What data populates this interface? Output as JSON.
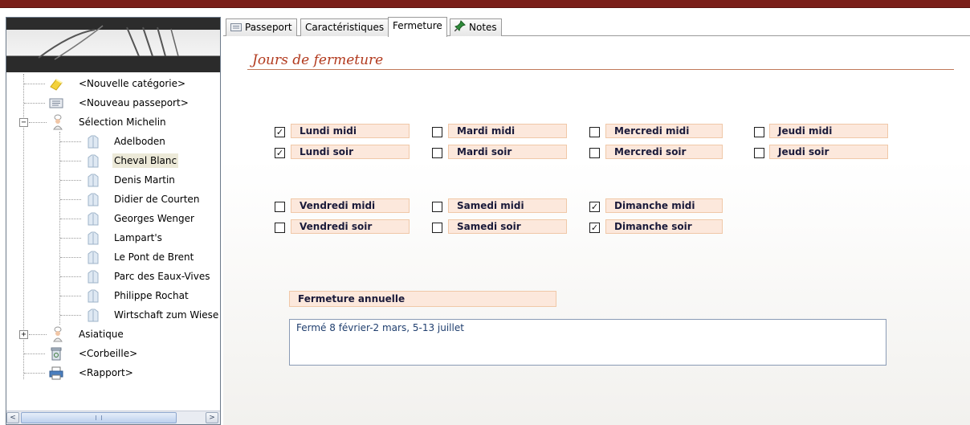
{
  "tree": {
    "items": [
      {
        "label": "<Nouvelle catégorie>",
        "icon": "folder-icon"
      },
      {
        "label": "<Nouveau passeport>",
        "icon": "document-icon"
      },
      {
        "label": "Sélection Michelin",
        "icon": "chef-icon",
        "expanded": true
      },
      {
        "label": "Adelboden",
        "icon": "chef-jacket-icon"
      },
      {
        "label": "Cheval Blanc",
        "icon": "chef-jacket-icon",
        "selected": true
      },
      {
        "label": "Denis Martin",
        "icon": "chef-jacket-icon"
      },
      {
        "label": "Didier de Courten",
        "icon": "chef-jacket-icon"
      },
      {
        "label": "Georges Wenger",
        "icon": "chef-jacket-icon"
      },
      {
        "label": "Lampart's",
        "icon": "chef-jacket-icon"
      },
      {
        "label": "Le Pont de Brent",
        "icon": "chef-jacket-icon"
      },
      {
        "label": "Parc des Eaux-Vives",
        "icon": "chef-jacket-icon"
      },
      {
        "label": "Philippe Rochat",
        "icon": "chef-jacket-icon"
      },
      {
        "label": "Wirtschaft zum Wiese",
        "icon": "chef-jacket-icon"
      },
      {
        "label": "Asiatique",
        "icon": "chef-icon",
        "expanded": false
      },
      {
        "label": "<Corbeille>",
        "icon": "recycle-bin-icon"
      },
      {
        "label": "<Rapport>",
        "icon": "printer-icon"
      }
    ],
    "expand_minus": "−",
    "expand_plus": "+",
    "scroll_left": "<",
    "scroll_right": ">"
  },
  "tabs": [
    {
      "label": "Passeport",
      "icon": "passport-icon",
      "active": false
    },
    {
      "label": "Caractéristiques",
      "active": false
    },
    {
      "label": "Fermeture",
      "active": true
    },
    {
      "label": "Notes",
      "icon": "pushpin-icon",
      "active": false
    }
  ],
  "closing": {
    "title": "Jours de fermeture",
    "days": [
      {
        "label": "Lundi midi",
        "checked": true
      },
      {
        "label": "Mardi midi",
        "checked": false
      },
      {
        "label": "Mercredi midi",
        "checked": false
      },
      {
        "label": "Jeudi midi",
        "checked": false
      },
      {
        "label": "Lundi soir",
        "checked": true
      },
      {
        "label": "Mardi soir",
        "checked": false
      },
      {
        "label": "Mercredi soir",
        "checked": false
      },
      {
        "label": "Jeudi soir",
        "checked": false
      },
      {
        "label": "Vendredi midi",
        "checked": false
      },
      {
        "label": "Samedi midi",
        "checked": false
      },
      {
        "label": "Dimanche midi",
        "checked": true
      },
      {
        "label": "Vendredi soir",
        "checked": false
      },
      {
        "label": "Samedi soir",
        "checked": false
      },
      {
        "label": "Dimanche soir",
        "checked": true
      }
    ],
    "annual_label": "Fermeture annuelle",
    "annual_value": "Fermé 8 février-2 mars, 5-13 juillet"
  },
  "colors": {
    "accent": "#b23a1e",
    "label_bg": "#fce8dc",
    "label_border": "#f0c8a8",
    "titlebar": "#7a1f1a"
  }
}
